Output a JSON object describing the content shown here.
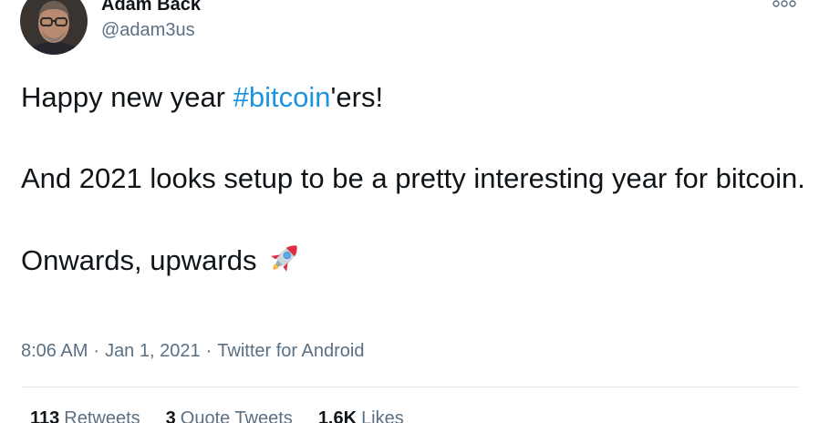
{
  "author": {
    "name": "Adam Back",
    "handle": "@adam3us",
    "avatar_icon": "profile-photo"
  },
  "tweet": {
    "line1_before": "Happy new year ",
    "line1_hashtag": "#bitcoin",
    "line1_after": "'ers!",
    "paragraph2": "And 2021 looks setup to be a pretty interesting year for bitcoin.",
    "paragraph3": "Onwards, upwards",
    "emoji_icon": "rocket-icon"
  },
  "meta": {
    "time": "8:06 AM",
    "separator": "·",
    "date": "Jan 1, 2021",
    "source": "Twitter for Android"
  },
  "stats": {
    "retweets_count": "113",
    "retweets_label": "Retweets",
    "quote_count": "3",
    "quote_label": "Quote Tweets",
    "likes_count": "1.6K",
    "likes_label": "Likes"
  },
  "colors": {
    "hashtag": "#1b95e0",
    "secondary_text": "#5b7083",
    "primary_text": "#0f1419"
  }
}
